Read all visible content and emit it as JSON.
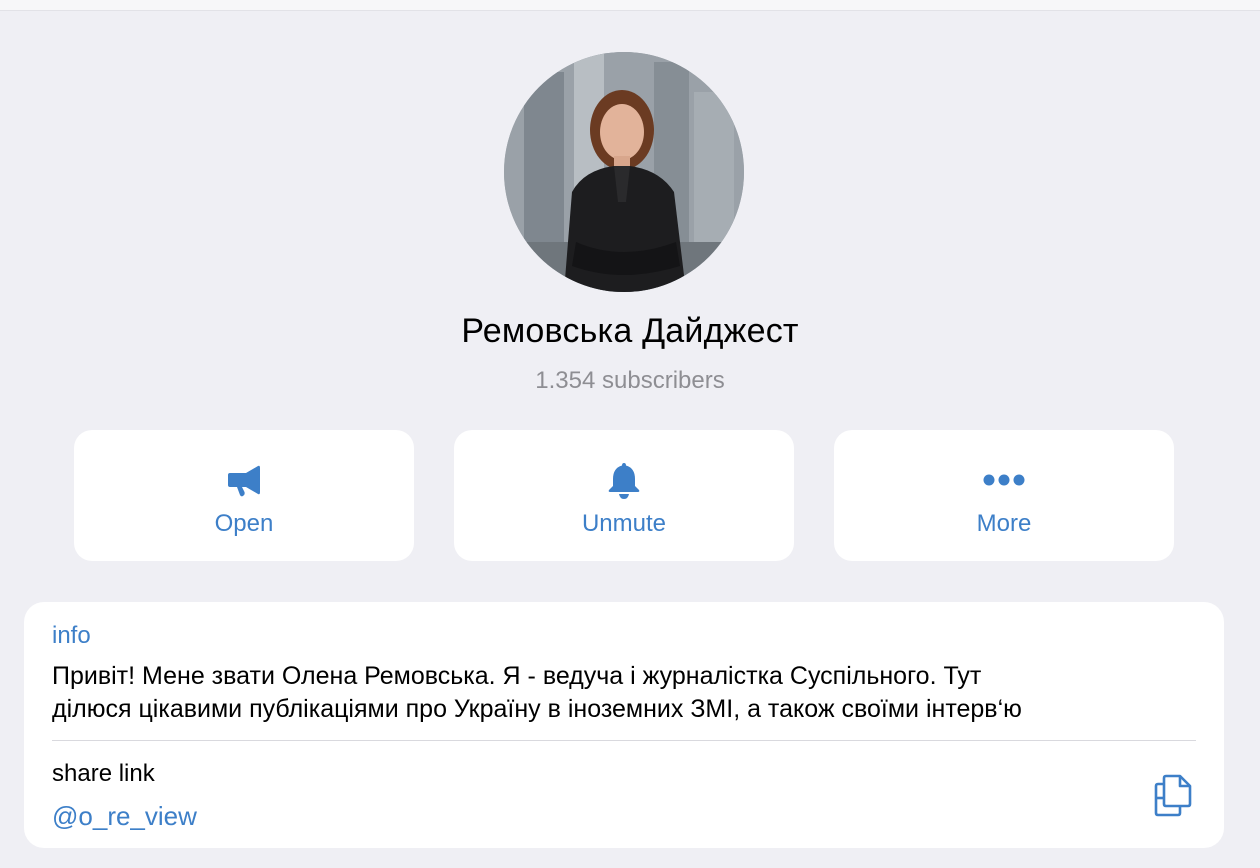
{
  "channel": {
    "name": "Ремовська Дайджест",
    "subscribers": "1.354 subscribers"
  },
  "actions": [
    {
      "label": "Open",
      "icon": "megaphone-icon"
    },
    {
      "label": "Unmute",
      "icon": "bell-icon"
    },
    {
      "label": "More",
      "icon": "ellipsis-icon"
    }
  ],
  "info": {
    "label": "info",
    "text_line1": "Привіт! Мене звати Олена Ремовська. Я - ведуча і журналістка Суспільного. Тут",
    "text_line2": "ділюся цікавими публікаціями про Україну в іноземних ЗМІ, а також своїми інтерв‘ю"
  },
  "share": {
    "label": "share link",
    "link": "@o_re_view",
    "copy_icon": "copy-icon"
  },
  "colors": {
    "accent": "#3d7fc8",
    "background": "#efeff4",
    "card": "#ffffff",
    "secondary_text": "#8e8e93"
  }
}
